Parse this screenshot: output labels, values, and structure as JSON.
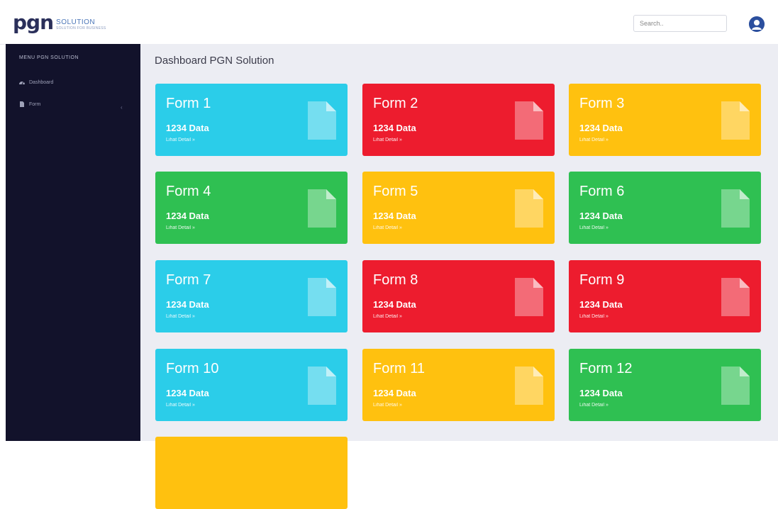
{
  "header": {
    "logo_main": "pgn",
    "logo_sub": "SOLUTION",
    "logo_tagline": "SOLUTION FOR BUSINESS",
    "search_placeholder": "Search..",
    "search_value": ""
  },
  "sidebar": {
    "menu_title": "MENU PGN SOLUTION",
    "items": [
      {
        "label": "Dashboard",
        "icon": "dashboard-icon"
      },
      {
        "label": "Form",
        "icon": "file-icon"
      }
    ]
  },
  "main": {
    "page_title": "Dashboard PGN Solution"
  },
  "cards": [
    {
      "title": "Form 1",
      "count": "1234 Data",
      "link": "Lihat Detail »",
      "color": "#2bcde9"
    },
    {
      "title": "Form 2",
      "count": "1234 Data",
      "link": "Lihat Detail »",
      "color": "#ed1c2e"
    },
    {
      "title": "Form 3",
      "count": "1234 Data",
      "link": "Lihat Detail »",
      "color": "#ffc10f"
    },
    {
      "title": "Form 4",
      "count": "1234 Data",
      "link": "Lihat Detail »",
      "color": "#2fc052"
    },
    {
      "title": "Form 5",
      "count": "1234 Data",
      "link": "Lihat Detail »",
      "color": "#ffc10f"
    },
    {
      "title": "Form 6",
      "count": "1234 Data",
      "link": "Lihat Detail »",
      "color": "#2fc052"
    },
    {
      "title": "Form 7",
      "count": "1234 Data",
      "link": "Lihat Detail »",
      "color": "#2bcde9"
    },
    {
      "title": "Form 8",
      "count": "1234 Data",
      "link": "Lihat Detail »",
      "color": "#ed1c2e"
    },
    {
      "title": "Form 9",
      "count": "1234 Data",
      "link": "Lihat Detail »",
      "color": "#ed1c2e"
    },
    {
      "title": "Form 10",
      "count": "1234 Data",
      "link": "Lihat Detail »",
      "color": "#2bcde9"
    },
    {
      "title": "Form 11",
      "count": "1234 Data",
      "link": "Lihat Detail »",
      "color": "#ffc10f"
    },
    {
      "title": "Form 12",
      "count": "1234 Data",
      "link": "Lihat Detail »",
      "color": "#2fc052"
    },
    {
      "title": "",
      "count": "",
      "link": "",
      "color": "#ffc10f"
    }
  ]
}
